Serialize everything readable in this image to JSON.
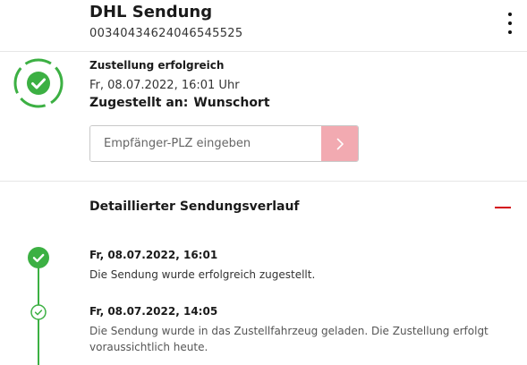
{
  "header": {
    "title": "DHL Sendung",
    "tracking_number": "00340434624046545525",
    "menu_icon": "more-vertical-icon"
  },
  "status": {
    "icon": "check-circle-icon",
    "label": "Zustellung erfolgreich",
    "datetime": "Fr, 08.07.2022, 16:01 Uhr",
    "delivered_to_label": "Zugestellt an:",
    "delivered_to_value": "Wunschort"
  },
  "plz_form": {
    "placeholder": "Empfänger-PLZ eingeben",
    "value": "",
    "submit_icon": "chevron-right-icon"
  },
  "history": {
    "title": "Detaillierter Sendungsverlauf",
    "collapse_icon": "minus-icon",
    "events": [
      {
        "date": "Fr, 08.07.2022, 16:01",
        "text": "Die Sendung wurde erfolgreich zugestellt.",
        "icon": "check-circle-filled-icon"
      },
      {
        "date": "Fr, 08.07.2022, 14:05",
        "text": "Die Sendung wurde in das Zustellfahrzeug geladen. Die Zustellung erfolgt voraussichtlich heute.",
        "icon": "check-circle-outline-icon"
      }
    ]
  },
  "colors": {
    "success_green": "#3cb043",
    "dhl_red": "#d40511",
    "submit_pink": "#f2aab1",
    "divider": "#e6e6e6"
  }
}
